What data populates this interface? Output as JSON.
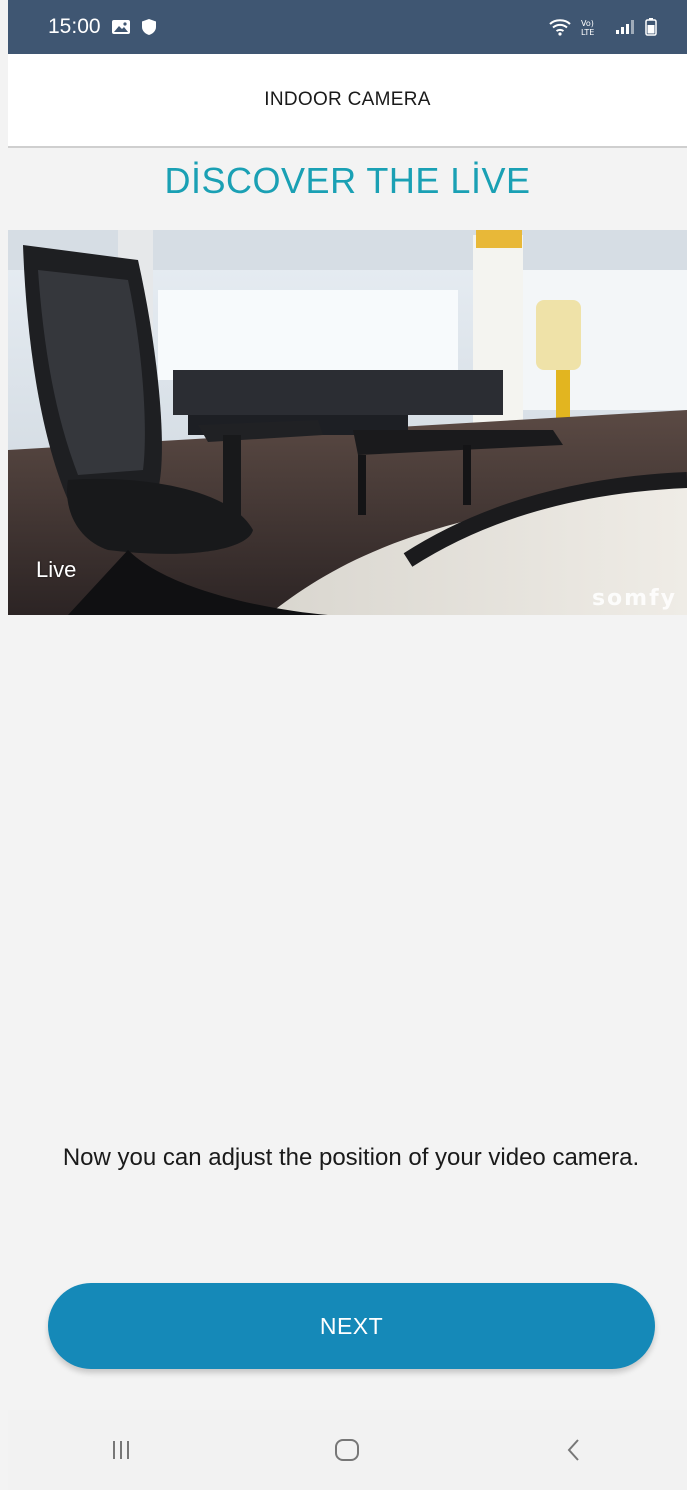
{
  "status_bar": {
    "time": "15:00",
    "icons": [
      "gallery-icon",
      "shield-icon",
      "wifi-icon",
      "volte-icon",
      "signal-icon",
      "battery-icon"
    ]
  },
  "header": {
    "title": "INDOOR CAMERA"
  },
  "discover": {
    "title": "DİSCOVER THE LİVE"
  },
  "video": {
    "live_label": "Live",
    "watermark": "somfy"
  },
  "instruction": {
    "text": "Now you can adjust the position of your video camera."
  },
  "actions": {
    "next_label": "NEXT"
  },
  "nav_bar": {
    "buttons": [
      "recent-apps-icon",
      "home-icon",
      "back-icon"
    ]
  },
  "colors": {
    "status_bar_bg": "#3f5672",
    "accent_title": "#1aa0b4",
    "button_bg": "#1589b8",
    "page_bg": "#f3f3f3"
  }
}
